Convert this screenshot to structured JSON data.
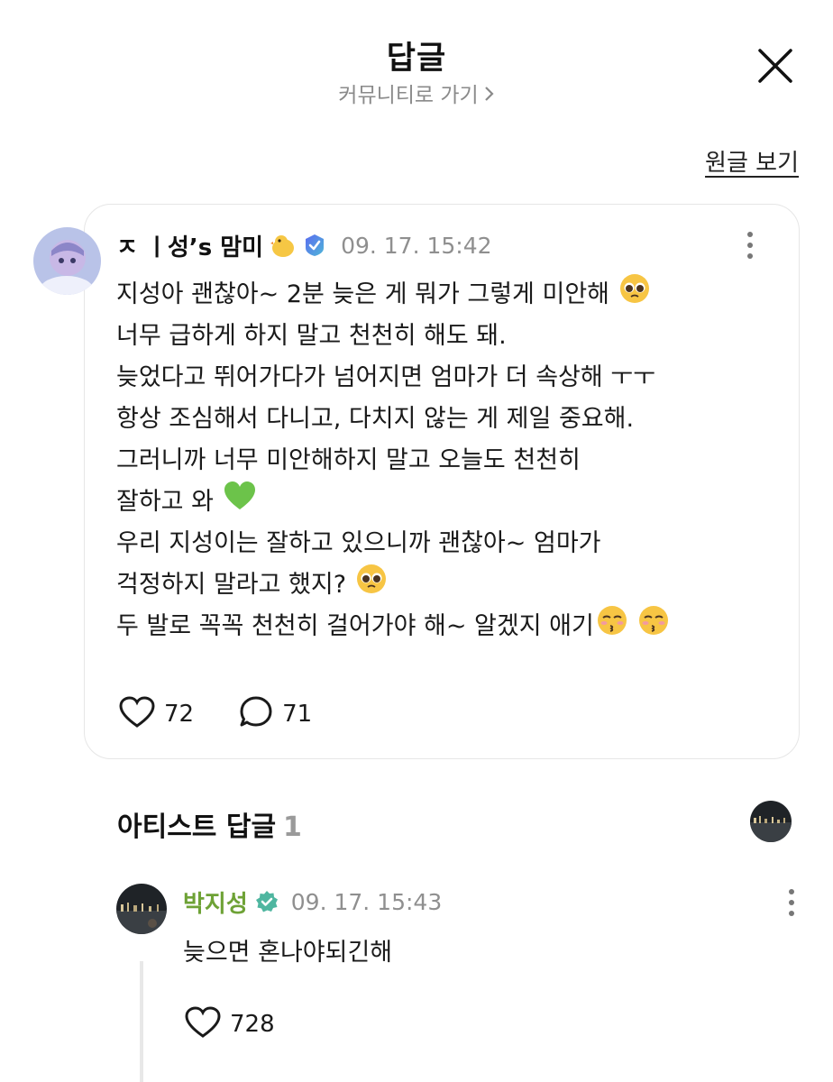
{
  "header": {
    "title": "답글",
    "subtitle": "커뮤니티로 가기",
    "subtitle_chevron": "chevron-right-icon",
    "close_icon": "close-icon"
  },
  "original_link": "원글 보기",
  "post": {
    "author": "ㅈ ㅣ성’s 맘미",
    "badges": [
      "chick-icon",
      "verified-badge-icon"
    ],
    "timestamp": "09. 17. 15:42",
    "lines": [
      "지성아 괜찮아~ 2분 늦은 게 뭐가 그렇게 미안해",
      "너무 급하게 하지 말고 천천히 해도 돼.",
      "늦었다고 뛰어가다가 넘어지면 엄마가 더 속상해 ㅜㅜ",
      "항상 조심해서 다니고, 다치지 않는 게 제일 중요해.",
      "그러니까 너무 미안해하지 말고 오늘도 천천히",
      "잘하고 와",
      "우리 지성이는 잘하고 있으니까 괜찮아~ 엄마가",
      "걱정하지 말라고 했지?",
      "두 발로 꼭꼭 천천히 걸어가야 해~ 알겠지 애기"
    ],
    "emojis": [
      "pleading-face-emoji",
      "green-heart-emoji",
      "pleading-face-emoji",
      "kissing-face-emoji",
      "kissing-face-emoji"
    ],
    "likes": "72",
    "comments": "71"
  },
  "artist_section": {
    "title": "아티스트 답글",
    "count": "1"
  },
  "reply": {
    "author": "박지성",
    "timestamp": "09. 17. 15:43",
    "text": "늦으면 혼나야되긴해",
    "likes": "728"
  },
  "colors": {
    "artist_name": "#6ea236",
    "verified_blue": "#5b6cf0",
    "verified_green": "#4fb6a0",
    "muted": "#8f8f8f"
  }
}
